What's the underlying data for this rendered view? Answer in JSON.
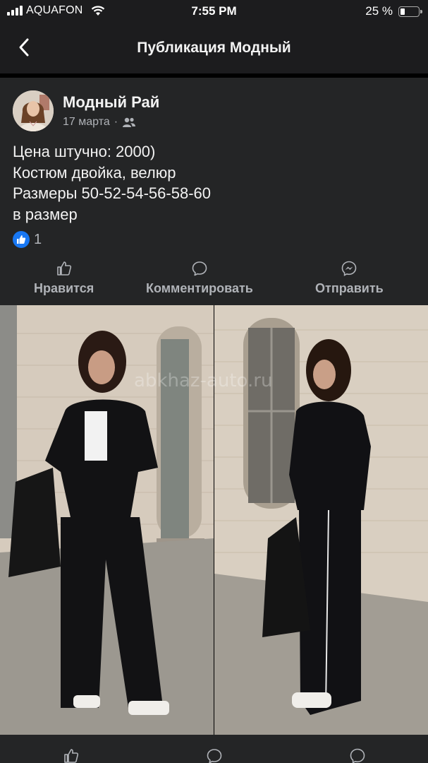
{
  "status_bar": {
    "carrier": "AQUAFON",
    "time": "7:55 PM",
    "battery_text": "25 %",
    "battery_level": 0.25
  },
  "nav": {
    "title": "Публикация Модный"
  },
  "post": {
    "author": "Модный Рай",
    "date": "17 марта",
    "separator": "·",
    "audience_icon": "friends-icon",
    "text_lines": [
      "Цена штучно: 2000)",
      "Костюм двойка, велюр",
      "Размеры 50-52-54-56-58-60",
      "в размер"
    ],
    "like_count": "1",
    "actions": {
      "like": "Нравится",
      "comment": "Комментировать",
      "share": "Отправить"
    },
    "image_watermark": "abkhaz-auto.ru"
  },
  "colors": {
    "background": "#1c1c1e",
    "card": "#242526",
    "accent": "#1877f2",
    "muted_text": "#b0b3b8"
  }
}
